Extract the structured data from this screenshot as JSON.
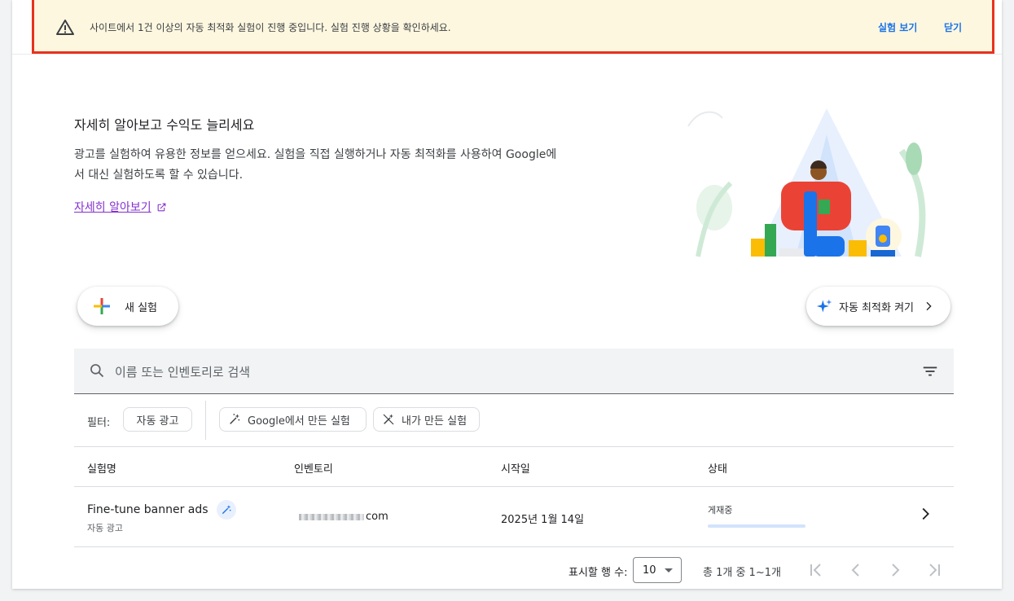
{
  "banner": {
    "message": "사이트에서 1건 이상의 자동 최적화 실험이 진행 중입니다. 실험 진행 상황을 확인하세요.",
    "view_label": "실험 보기",
    "close_label": "닫기",
    "background_color": "#fef7e0",
    "highlight_border_color": "#e8321e"
  },
  "hero": {
    "title": "자세히 알아보고 수익도 늘리세요",
    "description": "광고를 실험하여 유용한 정보를 얻으세요. 실험을 직접 실행하거나 자동 최적화를 사용하여 Google에서 대신 실험하도록 할 수 있습니다.",
    "learn_more_label": "자세히 알아보기"
  },
  "actions": {
    "new_experiment_label": "새 실험",
    "auto_optimize_label": "자동 최적화 켜기"
  },
  "search": {
    "placeholder": "이름 또는 인벤토리로 검색"
  },
  "filters": {
    "label": "필터:",
    "chips": [
      "자동 광고",
      "Google에서 만든 실험",
      "내가 만든 실험"
    ]
  },
  "table": {
    "columns": [
      "실험명",
      "인벤토리",
      "시작일",
      "상태"
    ],
    "rows": [
      {
        "name": "Fine-tune banner ads",
        "type": "자동 광고",
        "inventory_suffix": "com",
        "start_date": "2025년 1월 14일",
        "status": "게재중"
      }
    ]
  },
  "pagination": {
    "rows_label": "표시할 행 수:",
    "rows_value": "10",
    "range": "총 1개 중 1~1개"
  },
  "colors": {
    "accent": "#1a73e8",
    "link_visited": "#8430ce",
    "status_bar": "#d2e3fc"
  }
}
